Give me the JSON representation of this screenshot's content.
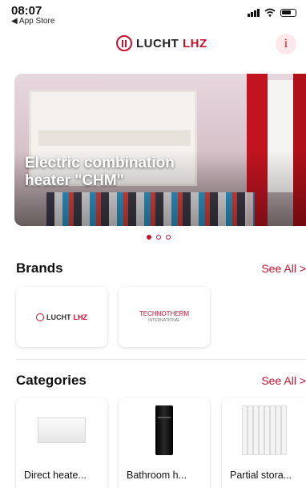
{
  "status_bar": {
    "time": "08:07",
    "back_label": "◀ App Store"
  },
  "header": {
    "brand_name_main": "LUCHT",
    "brand_name_accent": "LHZ",
    "info_label": "i"
  },
  "banner": {
    "caption": "Electric combination heater \"CHM\"",
    "page_count": 3,
    "active_index": 0
  },
  "brands": {
    "title": "Brands",
    "see_all": "See All >",
    "items": [
      {
        "name_main": "LUCHT",
        "name_accent": "LHZ"
      },
      {
        "name": "TECHNOTHERM",
        "sub": "INTERNATIONAL"
      }
    ]
  },
  "categories": {
    "title": "Categories",
    "see_all": "See All >",
    "items": [
      {
        "label": "Direct heate..."
      },
      {
        "label": "Bathroom h..."
      },
      {
        "label": "Partial stora..."
      }
    ]
  },
  "colors": {
    "accent": "#c8102e"
  }
}
